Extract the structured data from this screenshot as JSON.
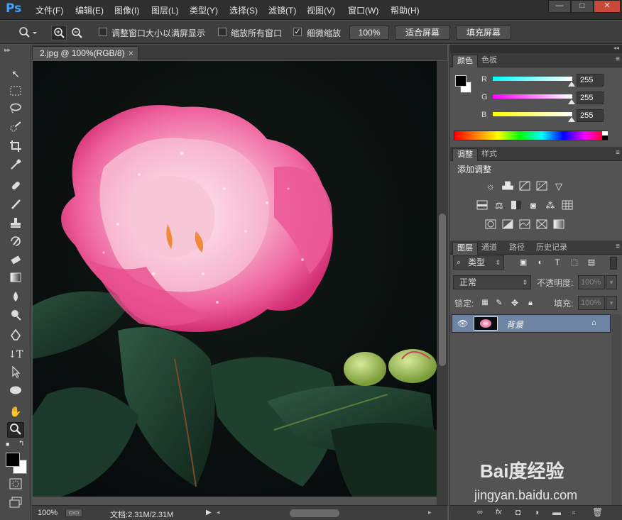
{
  "app": {
    "logo": "Ps"
  },
  "menu": [
    "文件(F)",
    "编辑(E)",
    "图像(I)",
    "图层(L)",
    "类型(Y)",
    "选择(S)",
    "滤镜(T)",
    "视图(V)",
    "窗口(W)",
    "帮助(H)"
  ],
  "window_buttons": {
    "min": "—",
    "max": "□",
    "close": "✕"
  },
  "options": {
    "resize_windows_label": "调整窗口大小以满屏显示",
    "zoom_all_label": "缩放所有窗口",
    "scrubby_zoom_label": "细微缩放",
    "scrubby_zoom_checked": true,
    "pct_button": "100%",
    "fit_screen_button": "适合屏幕",
    "fill_screen_button": "填充屏幕"
  },
  "document": {
    "tab_title": "2.jpg @ 100%(RGB/8)",
    "tab_close": "×",
    "zoom": "100%",
    "doc_info": "文档:2.31M/2.31M"
  },
  "color_panel": {
    "tabs": [
      "颜色",
      "色板"
    ],
    "channels": [
      {
        "label": "R",
        "value": "255",
        "color": "#00ffff"
      },
      {
        "label": "G",
        "value": "255",
        "color": "#ff00ff"
      },
      {
        "label": "B",
        "value": "255",
        "color": "#ffff00"
      }
    ]
  },
  "adjust_panel": {
    "tabs": [
      "调整",
      "样式"
    ],
    "title": "添加调整"
  },
  "layers_panel": {
    "tabs": [
      "图层",
      "通道",
      "路径",
      "历史记录"
    ],
    "filter_kind": "类型",
    "blend_mode": "正常",
    "opacity_label": "不透明度:",
    "opacity_value": "100%",
    "lock_label": "锁定:",
    "fill_label": "填充:",
    "fill_value": "100%",
    "layers": [
      {
        "name": "背景",
        "visible": true,
        "locked": true
      }
    ]
  },
  "watermark": {
    "brand": "Bai度经验",
    "url": "jingyan.baidu.com"
  }
}
